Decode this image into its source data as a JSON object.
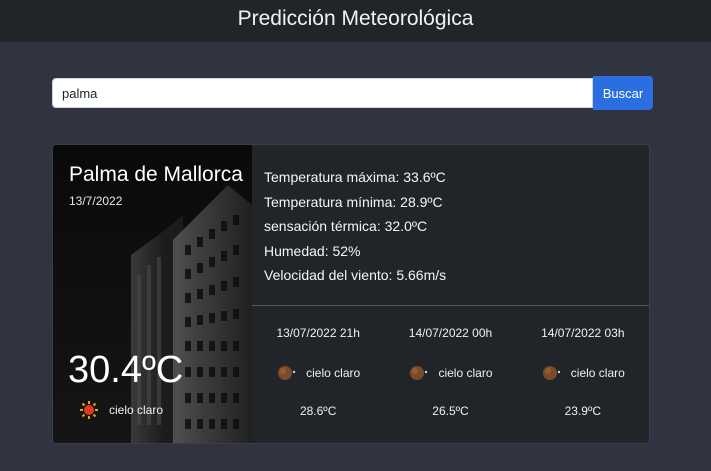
{
  "header": {
    "title": "Predicción Meteorológica"
  },
  "search": {
    "value": "palma",
    "button_label": "Buscar"
  },
  "current": {
    "city": "Palma de Mallorca",
    "date": "13/7/2022",
    "temperature": "30.4ºC",
    "condition": "cielo claro",
    "condition_icon": "sun-icon"
  },
  "details": {
    "max_temp": "Temperatura máxima: 33.6ºC",
    "min_temp": "Temperatura mínima: 28.9ºC",
    "feels_like": "sensación térmica: 32.0ºC",
    "humidity": "Humedad: 52%",
    "wind": "Velocidad del viento: 5.66m/s"
  },
  "forecast": [
    {
      "time": "13/07/2022 21h",
      "condition": "cielo claro",
      "icon": "moon-icon",
      "temp": "28.6ºC"
    },
    {
      "time": "14/07/2022 00h",
      "condition": "cielo claro",
      "icon": "moon-icon",
      "temp": "26.5ºC"
    },
    {
      "time": "14/07/2022 03h",
      "condition": "cielo claro",
      "icon": "moon-icon",
      "temp": "23.9ºC"
    }
  ],
  "colors": {
    "page_bg": "#2f3440",
    "topbar_bg": "#212529",
    "card_bg": "#212529",
    "button_bg": "#2a6ee0"
  }
}
